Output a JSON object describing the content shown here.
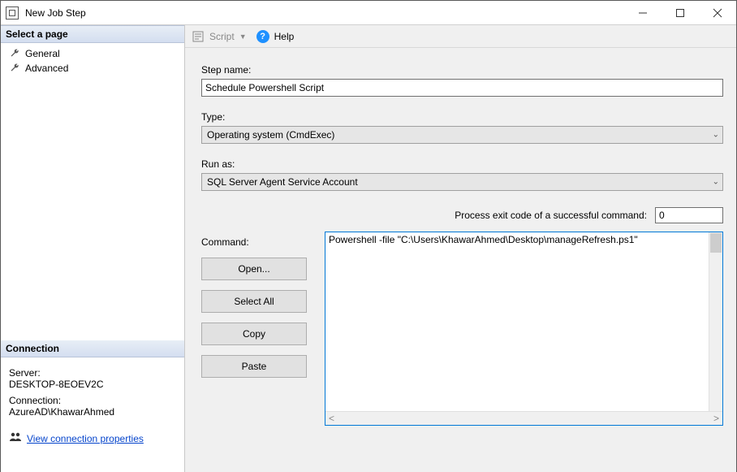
{
  "window": {
    "title": "New Job Step"
  },
  "sidebar": {
    "select_page": "Select a page",
    "items": [
      {
        "label": "General"
      },
      {
        "label": "Advanced"
      }
    ],
    "connection_header": "Connection",
    "server_label": "Server:",
    "server_value": "DESKTOP-8EOEV2C",
    "conn_label": "Connection:",
    "conn_value": "AzureAD\\KhawarAhmed",
    "view_conn": "View connection properties"
  },
  "toolbar": {
    "script": "Script",
    "help": "Help"
  },
  "form": {
    "step_name_label": "Step name:",
    "step_name_value": "Schedule Powershell Script",
    "type_label": "Type:",
    "type_value": "Operating system (CmdExec)",
    "runas_label": "Run as:",
    "runas_value": "SQL Server Agent Service Account",
    "exitcode_label": "Process exit code of a successful command:",
    "exitcode_value": "0",
    "command_label": "Command:",
    "command_value": "Powershell -file \"C:\\Users\\KhawarAhmed\\Desktop\\manageRefresh.ps1\"",
    "buttons": {
      "open": "Open...",
      "select_all": "Select All",
      "copy": "Copy",
      "paste": "Paste"
    }
  }
}
